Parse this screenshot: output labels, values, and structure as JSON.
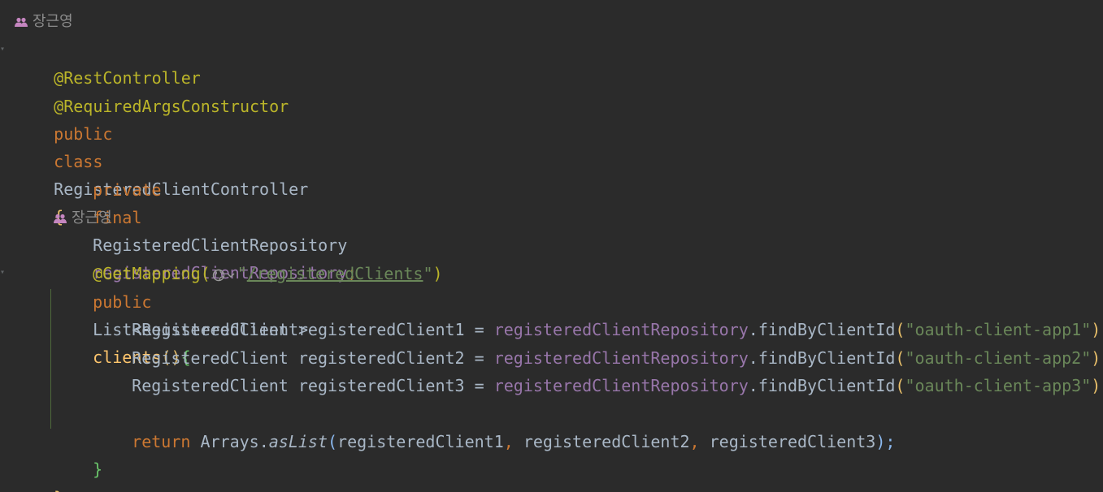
{
  "file": {
    "author": "장근영",
    "lines": {
      "annotation_rest": "@RestController",
      "annotation_required": "@RequiredArgsConstructor",
      "class_public": "public",
      "class_kw": "class",
      "class_name": "RegisteredClientController",
      "class_open": "{",
      "field_private": "private",
      "field_final": "final",
      "field_type": "RegisteredClientRepository",
      "field_name": "registeredClientRepository",
      "field_semi": ";",
      "method_author": "장근영",
      "getmapping": "@GetMapping(",
      "getmapping_quote_open": "\"",
      "getmapping_url": "/registeredClients",
      "getmapping_quote_close": "\"",
      "getmapping_close": ")",
      "method_public": "public",
      "method_return_type_open": "List<",
      "method_return_type_inner": "RegisteredClient",
      "method_return_type_close": ">",
      "method_name": "clients",
      "method_parens": "()",
      "method_open": "{",
      "stmt1_decl": "RegisteredClient registeredClient1 = ",
      "stmt2_decl": "RegisteredClient registeredClient2 = ",
      "stmt3_decl": "RegisteredClient registeredClient3 = ",
      "repo_ref": "registeredClientRepository",
      "find_call": ".findByClientId",
      "paren_open": "(",
      "paren_close": ")",
      "semi": ";",
      "arg1": "\"oauth-client-app1\"",
      "arg2": "\"oauth-client-app2\"",
      "arg3": "\"oauth-client-app3\"",
      "return_kw": "return",
      "arrays": " Arrays.",
      "aslist": "asList",
      "return_args_1": "registeredClient1",
      "comma": ",",
      "return_args_2": " registeredClient2",
      "return_args_3": " registeredClient3",
      "return_close": ");",
      "method_close": "}",
      "class_close": "}"
    }
  },
  "icons": {
    "author_icon": "people-icon",
    "url_icon": "globe-icon"
  },
  "colors": {
    "background": "#2b2b2b",
    "annotation": "#bbb529",
    "keyword": "#cc7832",
    "field": "#9876aa",
    "string": "#6a8759",
    "method": "#ffc66d",
    "text": "#a9b7c6"
  }
}
